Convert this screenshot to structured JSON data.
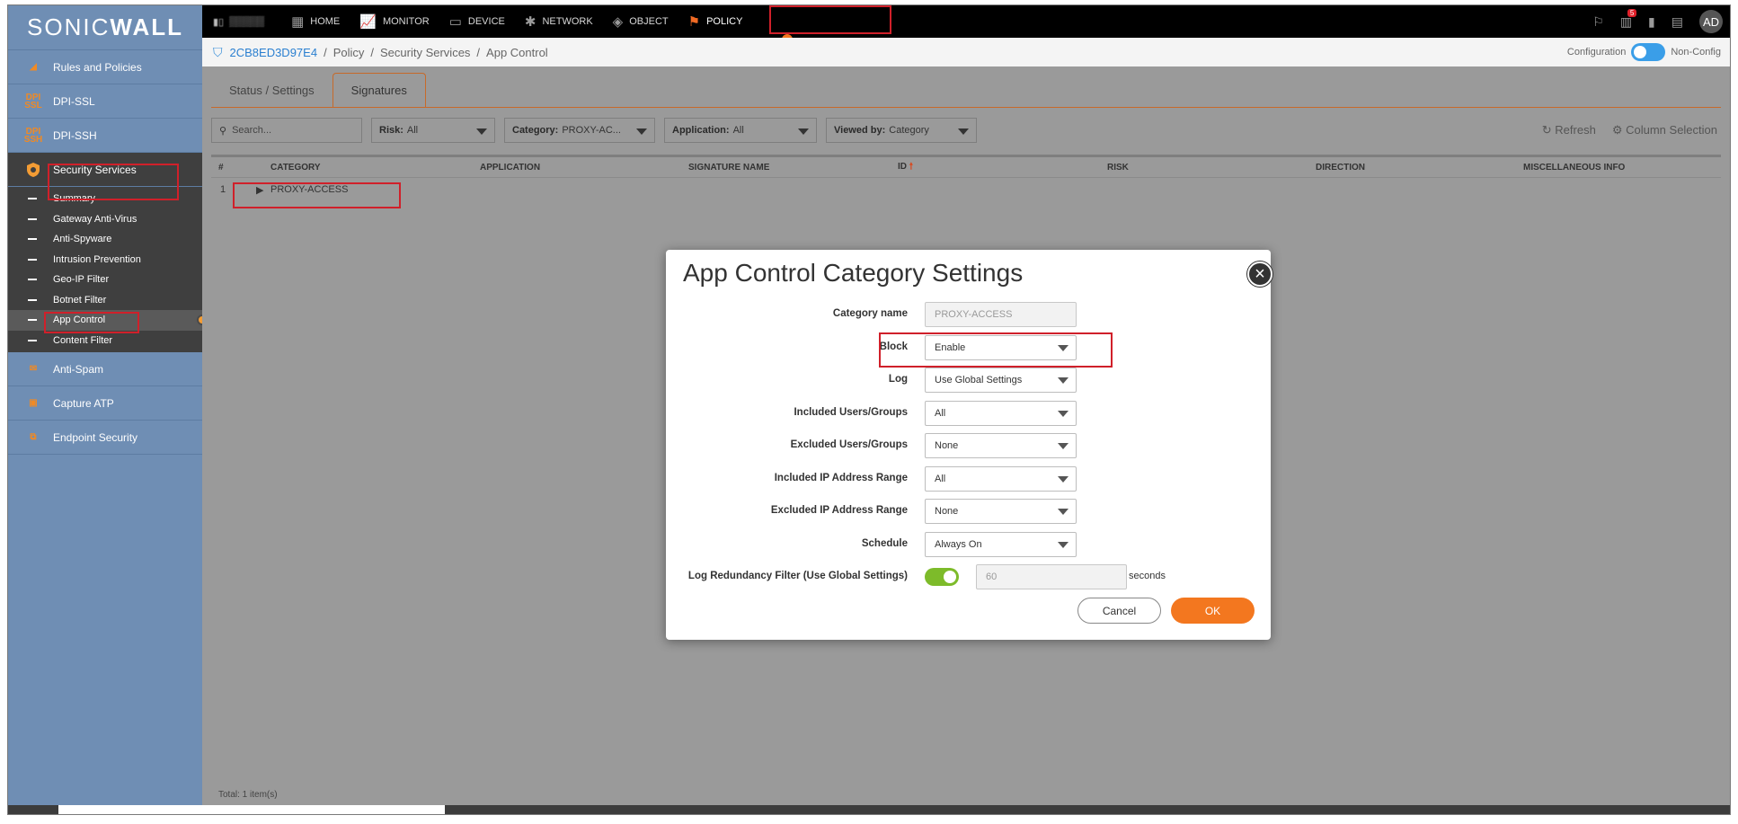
{
  "app": {
    "logo_part1": "SONIC",
    "logo_part2": "WALL"
  },
  "sidebar": {
    "top_items": [
      {
        "label": "Rules and Policies",
        "icon": "rules-icon"
      },
      {
        "label": "DPI-SSL",
        "icon": "dpi-ssl-icon"
      },
      {
        "label": "DPI-SSH",
        "icon": "dpi-ssh-icon"
      },
      {
        "label": "Security Services",
        "icon": "security-services-icon"
      }
    ],
    "sub_items": [
      "Summary",
      "Gateway Anti-Virus",
      "Anti-Spyware",
      "Intrusion Prevention",
      "Geo-IP Filter",
      "Botnet Filter",
      "App Control",
      "Content Filter"
    ],
    "bottom_items": [
      {
        "label": "Anti-Spam",
        "icon": "anti-spam-icon"
      },
      {
        "label": "Capture ATP",
        "icon": "capture-atp-icon"
      },
      {
        "label": "Endpoint Security",
        "icon": "endpoint-security-icon"
      }
    ]
  },
  "topnav": {
    "items": [
      "HOME",
      "MONITOR",
      "DEVICE",
      "NETWORK",
      "OBJECT",
      "POLICY"
    ],
    "active": "POLICY",
    "notification_count": "5",
    "avatar": "AD"
  },
  "breadcrumb": {
    "node": "2CB8ED3D97E4",
    "path": [
      "Policy",
      "Security Services",
      "App Control"
    ]
  },
  "mode": {
    "left": "Configuration",
    "right": "Non-Config"
  },
  "tabs": [
    "Status / Settings",
    "Signatures"
  ],
  "filters": {
    "search_placeholder": "Search...",
    "risk_label": "Risk:",
    "risk_value": "All",
    "category_label": "Category:",
    "category_value": "PROXY-AC...",
    "application_label": "Application:",
    "application_value": "All",
    "viewed_label": "Viewed by:",
    "viewed_value": "Category",
    "refresh": "Refresh",
    "column_selection": "Column Selection"
  },
  "table": {
    "headers": [
      "#",
      "CATEGORY",
      "APPLICATION",
      "SIGNATURE NAME",
      "ID",
      "RISK",
      "DIRECTION",
      "MISCELLANEOUS INFO"
    ],
    "rows": [
      {
        "num": "1",
        "category": "PROXY-ACCESS"
      }
    ],
    "total": "Total: 1 item(s)"
  },
  "modal": {
    "title": "App Control Category Settings",
    "fields": {
      "category_name_label": "Category name",
      "category_name_value": "PROXY-ACCESS",
      "block_label": "Block",
      "block_value": "Enable",
      "log_label": "Log",
      "log_value": "Use Global Settings",
      "incl_users_label": "Included Users/Groups",
      "incl_users_value": "All",
      "excl_users_label": "Excluded Users/Groups",
      "excl_users_value": "None",
      "incl_ip_label": "Included IP Address Range",
      "incl_ip_value": "All",
      "excl_ip_label": "Excluded IP Address Range",
      "excl_ip_value": "None",
      "schedule_label": "Schedule",
      "schedule_value": "Always On",
      "log_redundancy_label": "Log Redundancy Filter (Use Global Settings)",
      "log_redundancy_seconds": "60",
      "seconds_unit": "seconds"
    },
    "cancel": "Cancel",
    "ok": "OK"
  },
  "colors": {
    "accent": "#f3771f",
    "sidebar": "#6f8eb4",
    "toggle_on": "#7dbb2a",
    "highlight": "#d0202a"
  }
}
